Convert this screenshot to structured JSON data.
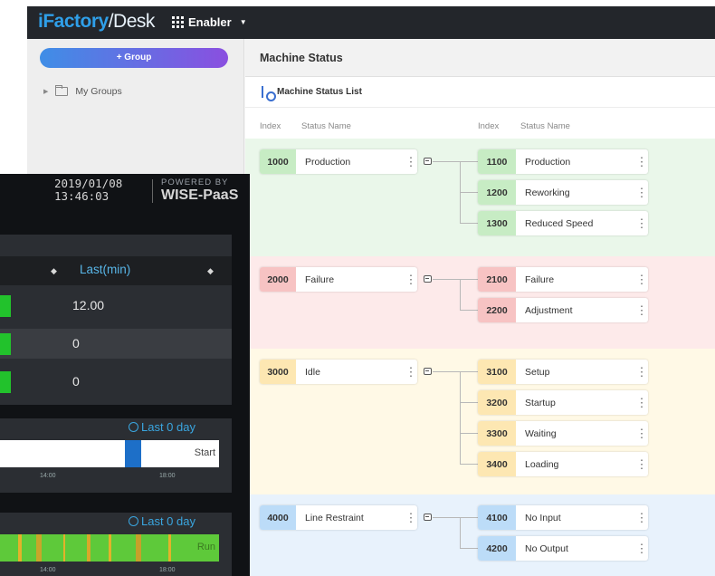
{
  "app": {
    "brand_part1": "iFactory",
    "brand_part2": "/Desk",
    "app_switch_label": "Enabler",
    "add_group_label": "+ Group",
    "tree_root_label": "My Groups",
    "page_title": "Machine Status",
    "list_title": "Machine Status List",
    "col_index": "Index",
    "col_status_name": "Status Name",
    "col_index_2": "Index",
    "col_status_name_2": "Status Name"
  },
  "groups": [
    {
      "index": "1000",
      "name": "Production",
      "bg": "#eaf7ea",
      "badge": "#c7ecc4",
      "children": [
        {
          "index": "1100",
          "name": "Production"
        },
        {
          "index": "1200",
          "name": "Reworking"
        },
        {
          "index": "1300",
          "name": "Reduced Speed"
        }
      ]
    },
    {
      "index": "2000",
      "name": "Failure",
      "bg": "#fdeaea",
      "badge": "#f7c3c3",
      "children": [
        {
          "index": "2100",
          "name": "Failure"
        },
        {
          "index": "2200",
          "name": "Adjustment"
        }
      ]
    },
    {
      "index": "3000",
      "name": "Idle",
      "bg": "#fff9e6",
      "badge": "#fde7b2",
      "children": [
        {
          "index": "3100",
          "name": "Setup"
        },
        {
          "index": "3200",
          "name": "Startup"
        },
        {
          "index": "3300",
          "name": "Waiting"
        },
        {
          "index": "3400",
          "name": "Loading"
        }
      ]
    },
    {
      "index": "4000",
      "name": "Line Restraint",
      "bg": "#e8f2fc",
      "badge": "#bcdcf8",
      "children": [
        {
          "index": "4100",
          "name": "No Input"
        },
        {
          "index": "4200",
          "name": "No Output"
        }
      ]
    }
  ],
  "dashboard": {
    "date": "2019/01/08",
    "time": "13:46:03",
    "powered_by": "POWERED BY",
    "platform": "WISE-PaaS",
    "column_header": "Last(min)",
    "values": [
      "12.00",
      "0",
      "0"
    ],
    "chart1_label": "Last 0 day",
    "chart1_state": "Start",
    "chart1_ticks": [
      "14:00",
      "18:00"
    ],
    "chart2_label": "Last 0 day",
    "chart2_state": "Run",
    "chart2_ticks": [
      "14:00",
      "18:00"
    ]
  }
}
